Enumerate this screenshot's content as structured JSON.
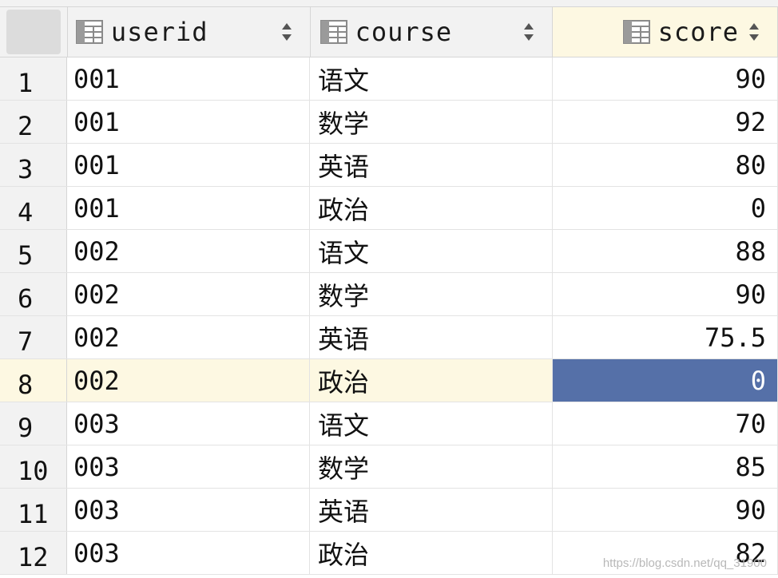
{
  "table": {
    "columns": [
      {
        "label": "userid",
        "icon": "column-icon"
      },
      {
        "label": "course",
        "icon": "column-icon"
      },
      {
        "label": "score",
        "icon": "column-icon"
      }
    ],
    "rows": [
      {
        "num": "1",
        "userid": "001",
        "course": "语文",
        "score": "90"
      },
      {
        "num": "2",
        "userid": "001",
        "course": "数学",
        "score": "92"
      },
      {
        "num": "3",
        "userid": "001",
        "course": "英语",
        "score": "80"
      },
      {
        "num": "4",
        "userid": "001",
        "course": "政治",
        "score": "0"
      },
      {
        "num": "5",
        "userid": "002",
        "course": "语文",
        "score": "88"
      },
      {
        "num": "6",
        "userid": "002",
        "course": "数学",
        "score": "90"
      },
      {
        "num": "7",
        "userid": "002",
        "course": "英语",
        "score": "75.5"
      },
      {
        "num": "8",
        "userid": "002",
        "course": "政治",
        "score": "0"
      },
      {
        "num": "9",
        "userid": "003",
        "course": "语文",
        "score": "70"
      },
      {
        "num": "10",
        "userid": "003",
        "course": "数学",
        "score": "85"
      },
      {
        "num": "11",
        "userid": "003",
        "course": "英语",
        "score": "90"
      },
      {
        "num": "12",
        "userid": "003",
        "course": "政治",
        "score": "82"
      }
    ],
    "current_row": "8",
    "selected_column": "score"
  },
  "colors": {
    "header_bg": "#f2f2f2",
    "current_row_bg": "#fdf8e2",
    "selected_cell_bg": "#5570a8",
    "grid_line": "#e3e3e3"
  },
  "watermark": "https://blog.csdn.net/qq_31900"
}
